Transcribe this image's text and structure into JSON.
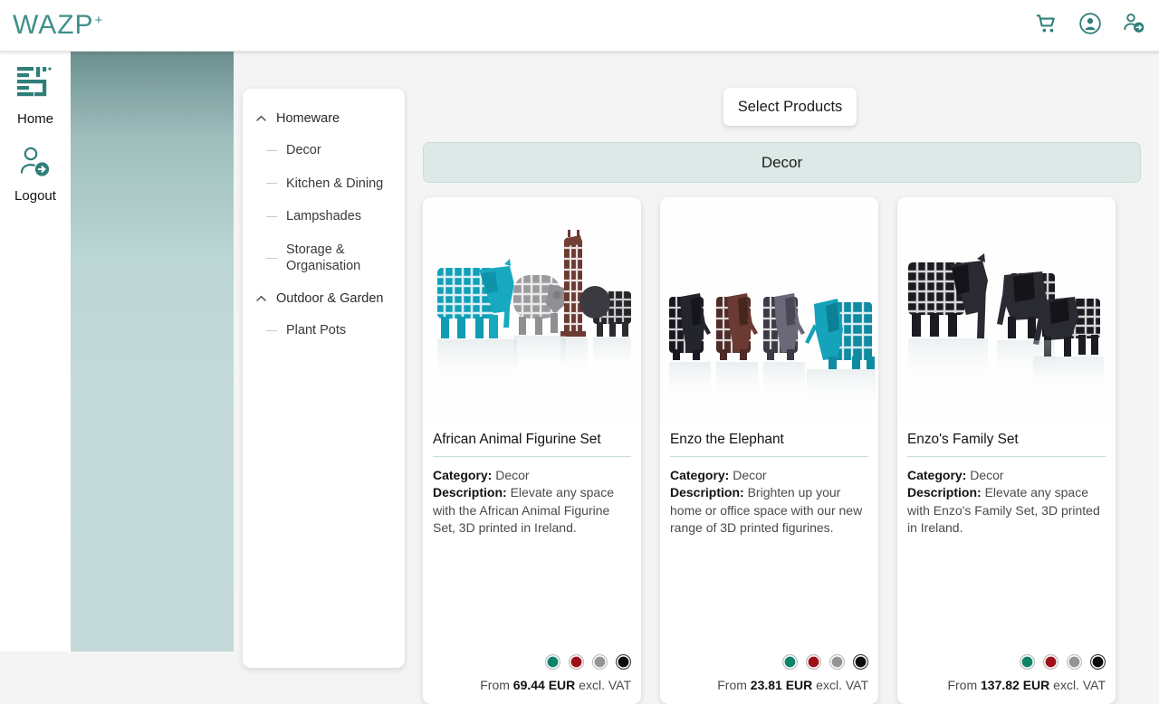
{
  "brand": {
    "name": "WAZP",
    "superscript": "+"
  },
  "topbar": {
    "icons": [
      {
        "name": "cart-icon",
        "label": "Cart"
      },
      {
        "name": "account-icon",
        "label": "Account"
      },
      {
        "name": "logout-icon",
        "label": "Logout"
      }
    ]
  },
  "rail": {
    "items": [
      {
        "icon": "wazp-logo-icon",
        "label": "Home"
      },
      {
        "icon": "user-logout-icon",
        "label": "Logout"
      }
    ]
  },
  "categories": [
    {
      "type": "group",
      "label": "Homeware",
      "expanded": true
    },
    {
      "type": "sub",
      "label": "Decor"
    },
    {
      "type": "sub",
      "label": "Kitchen & Dining"
    },
    {
      "type": "sub",
      "label": "Lampshades"
    },
    {
      "type": "sub",
      "label": "Storage & Organisation"
    },
    {
      "type": "group",
      "label": "Outdoor & Garden",
      "expanded": true
    },
    {
      "type": "sub",
      "label": "Plant Pots"
    }
  ],
  "main": {
    "select_products_label": "Select Products",
    "category_banner": "Decor",
    "labels": {
      "category": "Category:",
      "description": "Description:",
      "from": "From",
      "excl_vat": "excl. VAT"
    }
  },
  "products": [
    {
      "title": "African Animal Figurine Set",
      "category": "Decor",
      "description": "Elevate any space with the African Animal Figurine Set, 3D printed in Ireland.",
      "price": "69.44 EUR",
      "swatches": [
        "#0f8367",
        "#9e1018",
        "#949494",
        "#0b0b0b"
      ],
      "image": "african-animal-figurine-set-photo"
    },
    {
      "title": "Enzo the Elephant",
      "category": "Decor",
      "description": "Brighten up your home or office space with our new range of 3D printed figurines.",
      "price": "23.81 EUR",
      "swatches": [
        "#0f8367",
        "#9e1018",
        "#949494",
        "#0b0b0b"
      ],
      "image": "enzo-the-elephant-photo"
    },
    {
      "title": "Enzo's Family Set",
      "category": "Decor",
      "description": "Elevate any space with Enzo's Family Set, 3D printed in Ireland.",
      "price": "137.82 EUR",
      "swatches": [
        "#0f8367",
        "#9e1018",
        "#949494",
        "#0b0b0b"
      ],
      "image": "enzos-family-set-photo"
    }
  ],
  "colors": {
    "brand_teal": "#3f908b",
    "panel_teal": "#c2d9d7",
    "banner_teal": "#dde9e7",
    "divider_teal": "#c5dcda",
    "page_bg": "#f4f4f4"
  }
}
